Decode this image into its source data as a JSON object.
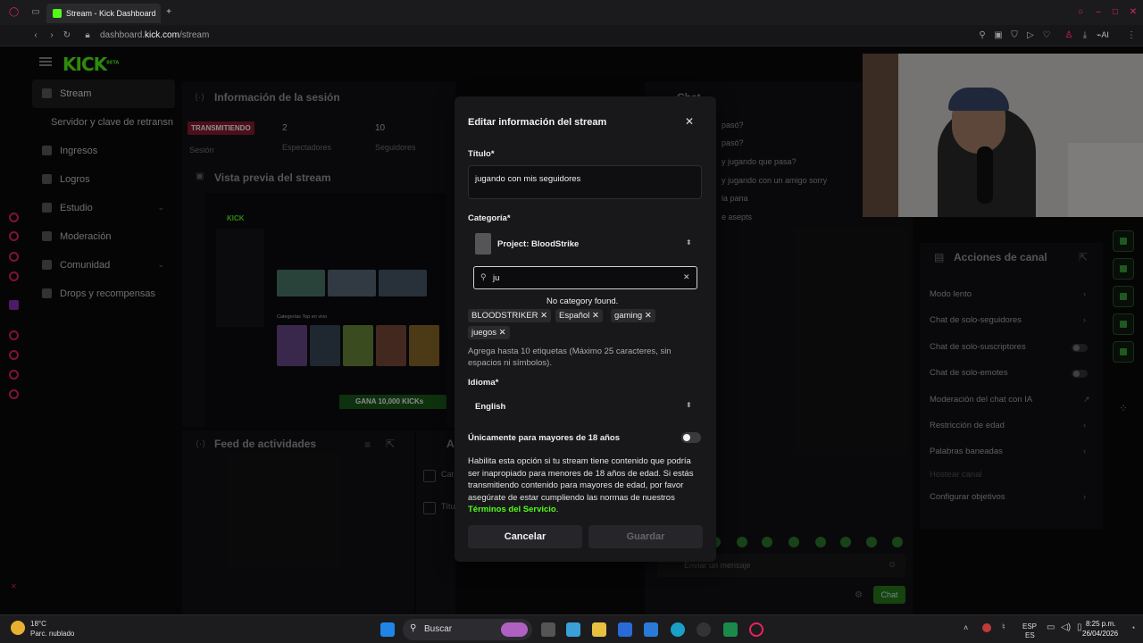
{
  "browser": {
    "tab_title": "Stream - Kick Dashboard",
    "url_prefix": "dashboard.",
    "url_domain": "kick.com",
    "url_path": "/stream",
    "ai_label": "AI"
  },
  "sidebar": {
    "logo": "KICK",
    "logo_badge": "BETA",
    "items": [
      {
        "label": "Stream",
        "icon": "broadcast-icon"
      },
      {
        "label": "Servidor y clave de retransn"
      },
      {
        "label": "Ingresos",
        "icon": "chart-icon"
      },
      {
        "label": "Logros",
        "icon": "trophy-icon"
      },
      {
        "label": "Estudio",
        "icon": "studio-icon"
      },
      {
        "label": "Moderación",
        "icon": "wrench-icon"
      },
      {
        "label": "Comunidad",
        "icon": "users-icon"
      },
      {
        "label": "Drops y recompensas",
        "icon": "gift-icon"
      }
    ]
  },
  "session": {
    "title": "Información de la sesión",
    "status_badge": "TRANSMITIENDO",
    "status_sub": "Sesión",
    "viewers_value": "2",
    "viewers_label": "Espectadores",
    "followers_value": "10",
    "followers_label": "Seguidores"
  },
  "preview": {
    "title": "Vista previa del stream",
    "banner": "GANA 10,000 KICKs",
    "category_heading": "Categorías Top en vivo"
  },
  "activity": {
    "title": "Feed de actividades",
    "side_letter": "A",
    "side_items": [
      "Cat",
      "Títu"
    ]
  },
  "chat": {
    "title": "Chat",
    "lines": [
      "pasó?",
      "pasó?",
      "y jugando que pasa?",
      "y jugando con un amigo sorry",
      "la pana",
      "e asepts"
    ],
    "input_placeholder": "Enviar un mensaje",
    "send_label": "Chat"
  },
  "channel_actions": {
    "title": "Acciones de canal",
    "items": [
      {
        "label": "Modo lento",
        "control": "chevron"
      },
      {
        "label": "Chat de solo-seguidores",
        "control": "chevron"
      },
      {
        "label": "Chat de solo-suscriptores",
        "control": "toggle"
      },
      {
        "label": "Chat de solo-emotes",
        "control": "toggle"
      },
      {
        "label": "Moderación del chat con IA",
        "control": "link"
      },
      {
        "label": "Restricción de edad",
        "control": "chevron"
      },
      {
        "label": "Palabras baneadas",
        "control": "chevron"
      },
      {
        "label": "Hostear canal",
        "control": "none"
      },
      {
        "label": "Configurar objetivos",
        "control": "chevron"
      }
    ]
  },
  "modal": {
    "title": "Editar información del stream",
    "title_label": "Título*",
    "title_value": "jugando con mis seguidores",
    "category_label": "Categoría*",
    "category_value": "Project: BloodStrike",
    "search_value": "ju",
    "no_results": "No category found.",
    "tags": [
      "BLOODSTRIKER",
      "Español",
      "gaming",
      "juegos"
    ],
    "tags_hint": "Agrega hasta 10 etiquetas (Máximo 25 caracteres, sin espacios ni símbolos).",
    "language_label": "Idioma*",
    "language_value": "English",
    "adult_label": "Únicamente para mayores de 18 años",
    "adult_enabled": false,
    "adult_desc": "Habilita esta opción si tu stream tiene contenido que podría ser inapropiado para menores de 18 años de edad. Si estás transmitiendo contenido para mayores de edad, por favor asegúrate de estar cumpliendo las normas de nuestros",
    "terms_link": "Términos del Servicio",
    "terms_end": ".",
    "cancel": "Cancelar",
    "save": "Guardar"
  },
  "taskbar": {
    "weather_temp": "18°C",
    "weather_desc": "Parc. nublado",
    "search_label": "Buscar",
    "lang_top": "ESP",
    "lang_bottom": "ES",
    "time": "8:25 p.m.",
    "date": "26/04/2026"
  },
  "colors": {
    "accent": "#53fc18",
    "live_red": "#e8245b",
    "modal_bg": "#18181b"
  }
}
